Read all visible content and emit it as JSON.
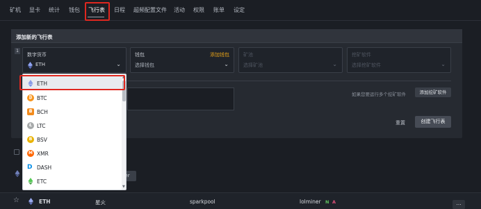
{
  "nav": {
    "tabs": [
      "矿机",
      "显卡",
      "统计",
      "钱包",
      "飞行表",
      "日程",
      "超频配置文件",
      "活动",
      "权限",
      "账单",
      "设定"
    ],
    "active_tab": "飞行表"
  },
  "panel": {
    "title": "添加新的飞行表",
    "row_number": "1",
    "coin": {
      "label": "数字货币",
      "value": "ETH"
    },
    "wallet": {
      "label": "钱包",
      "add_link": "添加钱包",
      "placeholder": "选择钱包"
    },
    "pool": {
      "label": "矿池",
      "placeholder": "选择矿池"
    },
    "miner": {
      "label": "挖矿软件",
      "placeholder": "选择挖矿软件"
    },
    "hint": "如果您要运行多个挖矿软件",
    "add_miner_button": "添加挖矿软件",
    "reset_button": "重置",
    "create_button": "创建飞行表"
  },
  "background_pill": "ner",
  "bottom_row": {
    "coin": "ETH",
    "wallet": "星火",
    "pool": "sparkpool",
    "miner": "lolminer",
    "flag_n": "N",
    "flag_a": "A",
    "more": "..."
  },
  "coin_dropdown": {
    "items": [
      {
        "symbol": "ETH",
        "icon": "eth-icon",
        "color": "#627eea"
      },
      {
        "symbol": "BTC",
        "icon": "btc-icon",
        "color": "#f7931a"
      },
      {
        "symbol": "BCH",
        "icon": "bch-icon",
        "color": "#f28b1d"
      },
      {
        "symbol": "LTC",
        "icon": "ltc-icon",
        "color": "#a6a9aa"
      },
      {
        "symbol": "BSV",
        "icon": "bsv-icon",
        "color": "#eab300"
      },
      {
        "symbol": "XMR",
        "icon": "xmr-icon",
        "color": "#ff6600"
      },
      {
        "symbol": "DASH",
        "icon": "dash-icon",
        "color": "#008ce7"
      },
      {
        "symbol": "ETC",
        "icon": "etc-icon",
        "color": "#3ab83a"
      }
    ],
    "selected": "ETH"
  },
  "colors": {
    "background": "#1b1e24",
    "panel": "#262a31",
    "accent_orange": "#e8a317",
    "highlight_red": "#e0271f"
  }
}
